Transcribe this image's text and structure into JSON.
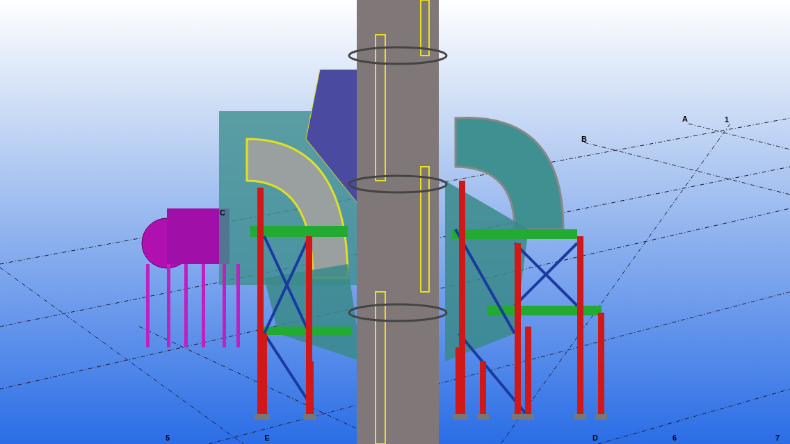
{
  "viewport": {
    "grid_labels": [
      "A",
      "1",
      "B",
      "C",
      "5",
      "E",
      "D",
      "6",
      "7"
    ]
  }
}
